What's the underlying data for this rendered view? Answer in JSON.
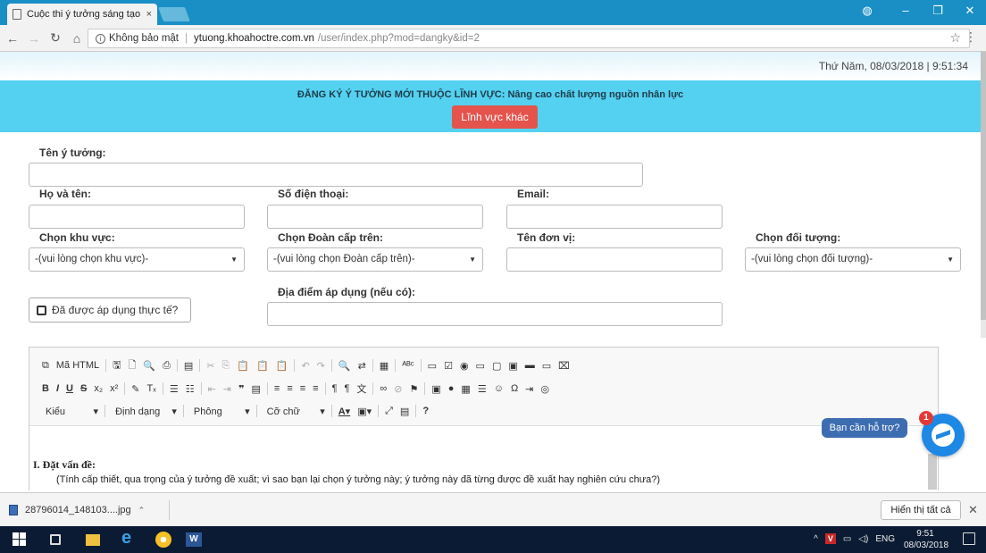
{
  "browser": {
    "tab_title": "Cuộc thi ý tưởng sáng tạo",
    "tab_close": "×",
    "security": "Không bảo mật",
    "url_host": "ytuong.khoahoctre.com.vn",
    "url_path": "/user/index.php?mod=dangky&id=2",
    "win_minimize": "–",
    "win_maximize": "❐",
    "win_close": "✕"
  },
  "page": {
    "datetime": "Thứ Năm, 08/03/2018 | 9:51:34",
    "banner_title": "ĐĂNG KÝ Ý TƯỞNG MỚI THUỘC LĨNH VỰC: Nâng cao chất lượng nguồn nhân lực",
    "other_field_button": "Lĩnh vực khác"
  },
  "form": {
    "idea_name_label": "Tên ý tưởng:",
    "full_name_label": "Họ và tên:",
    "phone_label": "Số điện thoại:",
    "email_label": "Email:",
    "region_label": "Chọn khu vực:",
    "region_value": "-(vui lòng chọn khu vực)-",
    "union_label": "Chọn Đoàn cấp trên:",
    "union_value": "-(vui lòng chọn Đoàn cấp trên)-",
    "unit_label": "Tên đơn vị:",
    "target_label": "Chọn đối tượng:",
    "target_value": "-(vui lòng chọn đối tượng)-",
    "applied_checkbox": "Đã được áp dụng thực tế?",
    "location_label": "Địa điểm áp dụng (nếu có):"
  },
  "editor": {
    "toolbar_row1": [
      "Mã HTML"
    ],
    "toolbar_row3": [
      "Kiểu",
      "Định dạng",
      "Phông",
      "Cỡ chữ"
    ],
    "heading": "I. Đặt vấn đề:",
    "paragraph": "(Tính cấp thiết, qua trọng của ý tưởng đề xuất; vì sao bạn lại chọn ý tưởng này; ý tưởng này đã từng được đề xuất hay nghiên cứu chưa?)"
  },
  "help": {
    "bubble": "Bạn cần hỗ trợ?",
    "badge": "1"
  },
  "downloads": {
    "file": "28796014_148103....jpg",
    "show_all": "Hiển thị tất cả"
  },
  "taskbar": {
    "language": "ENG",
    "time": "9:51",
    "date": "08/03/2018"
  }
}
